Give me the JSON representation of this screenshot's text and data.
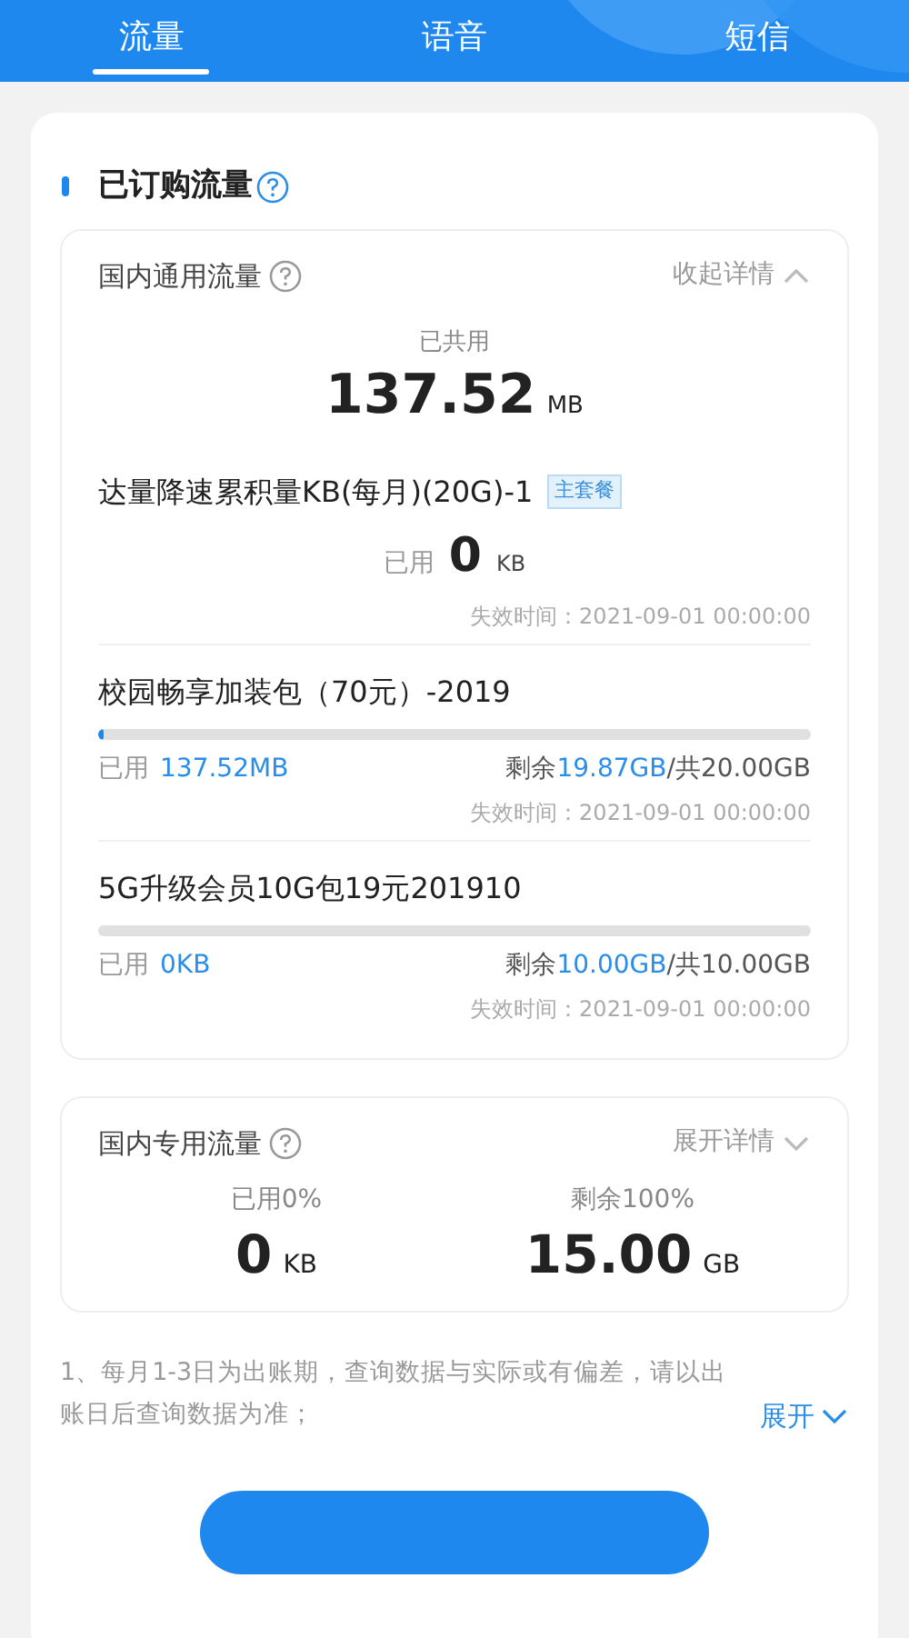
{
  "tabs": [
    {
      "label": "流量",
      "selected": true
    },
    {
      "label": "语音",
      "selected": false
    },
    {
      "label": "短信",
      "selected": false
    }
  ],
  "section_title": "已订购流量",
  "groups": [
    {
      "title": "国内通用流量",
      "toggle": "收起详情",
      "expanded": true,
      "summary_label": "已共用",
      "summary_value": "137.52",
      "summary_unit": "MB",
      "packages": [
        {
          "kind": "plain",
          "name": "达量降速累积量KB(每月)(20G)-1",
          "badge": "主套餐",
          "used_label": "已用",
          "used_value": "0",
          "used_unit": "KB",
          "expiry": "失效时间：2021-09-01 00:00:00"
        },
        {
          "kind": "bar",
          "name": "校园畅享加装包（70元）-2019",
          "level": 0.007,
          "used_label": "已用",
          "used_value": "137.52MB",
          "remaining_label": "剩余",
          "remaining_value": "19.87GB",
          "total": "/共20.00GB",
          "expiry": "失效时间：2021-09-01 00:00:00"
        },
        {
          "kind": "bar",
          "name": "5G升级会员10G包19元201910",
          "level": 0,
          "used_label": "已用",
          "used_value": "0KB",
          "remaining_label": "剩余",
          "remaining_value": "10.00GB",
          "total": "/共10.00GB",
          "expiry": "失效时间：2021-09-01 00:00:00"
        }
      ]
    },
    {
      "title": "国内专用流量",
      "toggle": "展开详情",
      "expanded": false,
      "stats": [
        {
          "label": "已用0%",
          "value": "0",
          "unit": "KB"
        },
        {
          "label": "剩余100%",
          "value": "15.00",
          "unit": "GB"
        }
      ]
    }
  ],
  "note": {
    "text": "1、每月1-3日为出账期，查询数据与实际或有偏差，请以出账日后查询数据为准；",
    "toggle": "展开",
    "expanded": false
  }
}
